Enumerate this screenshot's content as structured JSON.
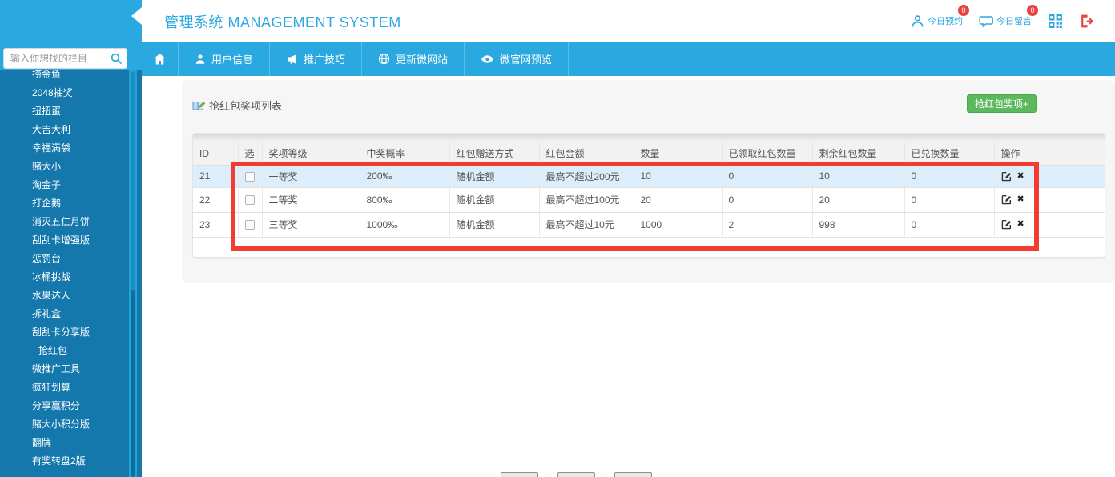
{
  "header": {
    "title": "管理系统 MANAGEMENT SYSTEM",
    "today_appointments": {
      "label": "今日预约",
      "badge": "0"
    },
    "today_messages": {
      "label": "今日留言",
      "badge": "0"
    }
  },
  "sidebar": {
    "search_placeholder": "输入你想找的栏目",
    "active_item": "抢红包",
    "items": [
      "捞金鱼",
      "2048抽奖",
      "扭扭蛋",
      "大吉大利",
      "幸福满袋",
      "赌大小",
      "淘金子",
      "打企鹅",
      "消灭五仁月饼",
      "刮刮卡增强版",
      "惩罚台",
      "冰桶挑战",
      "水果达人",
      "拆礼盒",
      "刮刮卡分享版",
      "抢红包",
      "微推广工具",
      "疯狂划算",
      "分享赢积分",
      "赌大小积分版",
      "翻牌",
      "有奖转盘2版"
    ]
  },
  "nav": {
    "items": [
      "用户信息",
      "推广技巧",
      "更新微网站",
      "微官网预览"
    ]
  },
  "main": {
    "title": "抢红包奖项列表",
    "add_button": "抢红包奖项+",
    "table": {
      "headers": [
        "ID",
        "选",
        "奖项等级",
        "中奖概率",
        "红包赠送方式",
        "红包金额",
        "数量",
        "已领取红包数量",
        "剩余红包数量",
        "已兑换数量",
        "操作"
      ],
      "rows": [
        {
          "id": "21",
          "level": "一等奖",
          "probability": "200‰",
          "method": "随机金额",
          "amount": "最高不超过200元",
          "quantity": "10",
          "claimed": "0",
          "remaining": "10",
          "redeemed": "0",
          "highlighted": true
        },
        {
          "id": "22",
          "level": "二等奖",
          "probability": "800‰",
          "method": "随机金额",
          "amount": "最高不超过100元",
          "quantity": "20",
          "claimed": "0",
          "remaining": "20",
          "redeemed": "0",
          "highlighted": false
        },
        {
          "id": "23",
          "level": "三等奖",
          "probability": "1000‰",
          "method": "随机金额",
          "amount": "最高不超过10元",
          "quantity": "1000",
          "claimed": "2",
          "remaining": "998",
          "redeemed": "0",
          "highlighted": false
        }
      ]
    }
  },
  "colors": {
    "accent_blue": "#29a9e0",
    "sidebar_blue": "#1478ad",
    "success_green": "#5cb85c",
    "highlight_red": "#f23b31",
    "badge_red": "#e8433f",
    "info_row_blue": "#dcedfb"
  }
}
